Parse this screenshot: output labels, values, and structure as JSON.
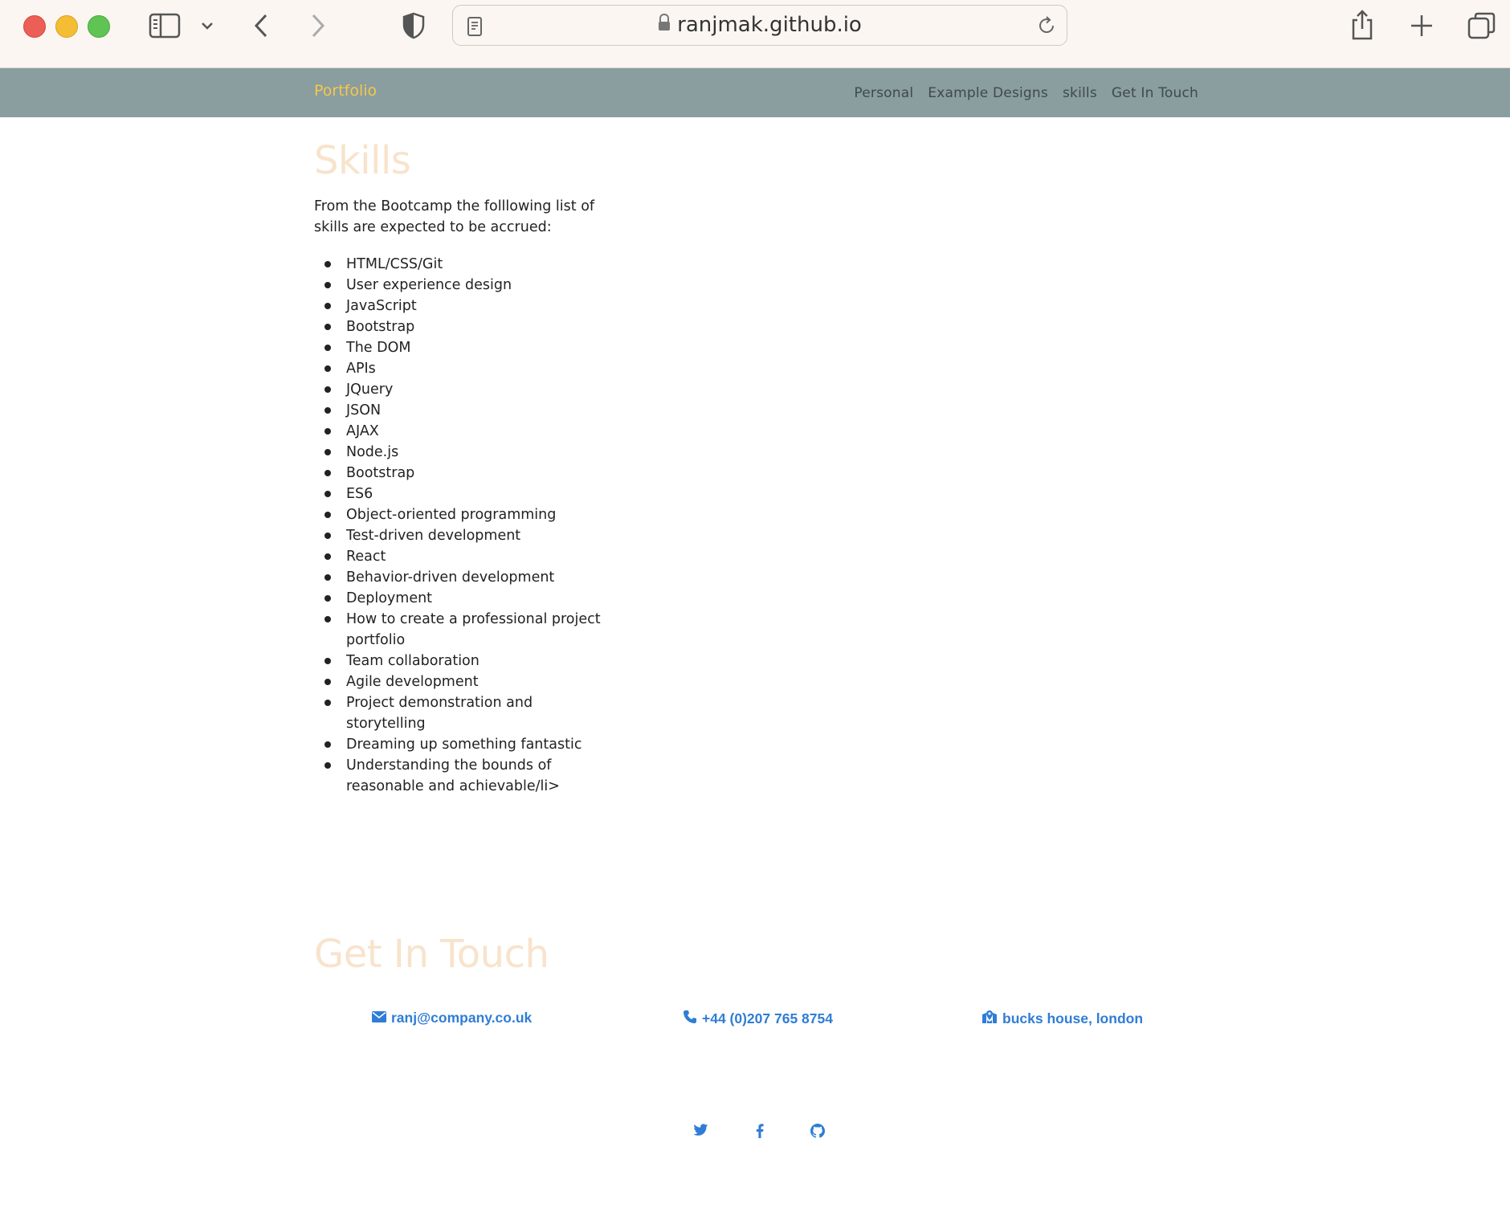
{
  "browser": {
    "url": "ranjmak.github.io"
  },
  "nav": {
    "brand": "Portfolio",
    "links": [
      "Personal",
      "Example Designs",
      "skills",
      "Get In Touch"
    ]
  },
  "skills": {
    "title": "Skills",
    "intro": "From the Bootcamp the folllowing list of skills are expected to be accrued:",
    "items": [
      "HTML/CSS/Git",
      "User experience design",
      "JavaScript",
      "Bootstrap",
      "The DOM",
      "APIs",
      "JQuery",
      "JSON",
      "AJAX",
      "Node.js",
      "Bootstrap",
      "ES6",
      "Object-oriented programming",
      "Test-driven development",
      "React",
      "Behavior-driven development",
      "Deployment",
      "How to create a professional project portfolio",
      "Team collaboration",
      "Agile development",
      "Project demonstration and storytelling",
      "Dreaming up something fantastic",
      "Understanding the bounds of reasonable and achievable/li>"
    ]
  },
  "contact": {
    "title": "Get In Touch",
    "email": "ranj@company.co.uk",
    "phone": "+44 (0)207 765 8754",
    "address": "bucks house, london"
  },
  "social": {
    "icons": [
      "twitter-icon",
      "facebook-icon",
      "github-icon"
    ]
  },
  "colors": {
    "navbar": "#8a9d9f",
    "brand": "#f6c84a",
    "heading": "#f8e3cc",
    "link": "#2f7dd6"
  }
}
